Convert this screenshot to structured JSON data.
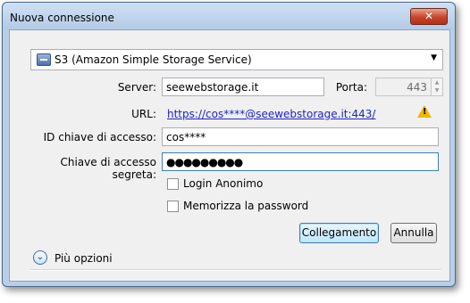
{
  "window": {
    "title": "Nuova connessione",
    "close_label": "✕"
  },
  "protocol": {
    "selected": "S3 (Amazon Simple Storage Service)"
  },
  "server": {
    "label": "Server:",
    "value": "seewebstorage.it"
  },
  "port": {
    "label": "Porta:",
    "value": "443"
  },
  "url": {
    "label": "URL:",
    "value": "https://cos****@seewebstorage.it:443/",
    "warning_icon": "warning-icon"
  },
  "access_key": {
    "label": "ID chiave di accesso:",
    "value": "cos****"
  },
  "secret_key": {
    "label": "Chiave di accesso segreta:",
    "value": "●●●●●●●●●"
  },
  "options": {
    "anonymous_login": "Login Anonimo",
    "save_password": "Memorizza la password"
  },
  "buttons": {
    "connect": "Collegamento",
    "cancel": "Annulla"
  },
  "more_options": {
    "label": "Più opzioni"
  }
}
